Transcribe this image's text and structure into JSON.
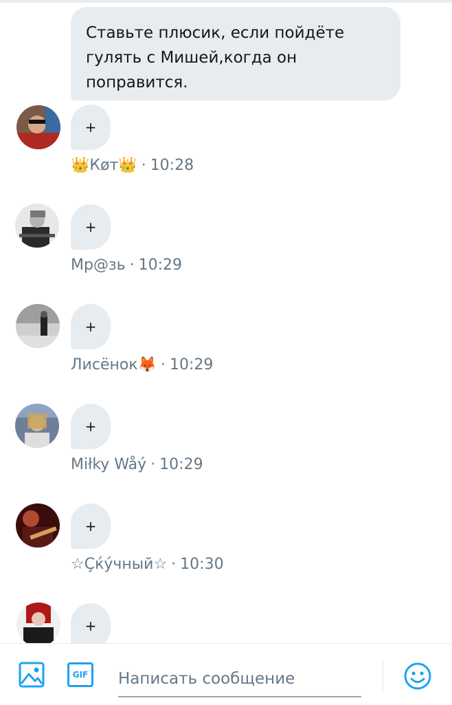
{
  "message": {
    "text": "Ставьте плюсик, если пойдёте гулять с Мишей,когда он поправится."
  },
  "replies": [
    {
      "text": "+",
      "author": "👑Кøт👑",
      "time": "10:28"
    },
    {
      "text": "+",
      "author": "Мр@зь",
      "time": "10:29"
    },
    {
      "text": "+",
      "author": "Лисёнок🦊",
      "time": "10:29"
    },
    {
      "text": "+",
      "author": "Miłky Wåý",
      "time": "10:29"
    },
    {
      "text": "+",
      "author": "☆Çќýчный☆",
      "time": "10:30"
    },
    {
      "text": "+"
    }
  ],
  "separator": "·",
  "composer": {
    "placeholder": "Написать сообщение",
    "gif_label": "GIF"
  },
  "colors": {
    "accent": "#1da1f2",
    "bubble": "#e6ecf0",
    "meta_text": "#657786"
  }
}
